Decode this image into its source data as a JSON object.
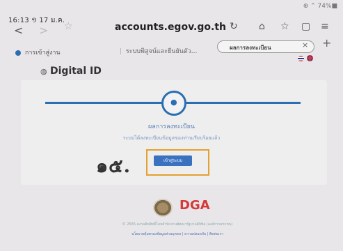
{
  "status_bar": {
    "time": "16:13 ១ 17 ม.ค.",
    "right": "⊕ ⌃ 74%■"
  },
  "browser": {
    "back": "<",
    "forward": ">",
    "url": "accounts.egov.go.th",
    "reload_icon": "reload-icon",
    "home_icon": "home-icon",
    "star_icon": "star-icon",
    "tabs_icon": "tabs-icon",
    "menu_icon": "menu-icon"
  },
  "tabs": [
    {
      "label": "การเข้าสู่งาน"
    },
    {
      "label": "ระบบพิสูจน์และยืนยันตัว..."
    },
    {
      "label": "ผลการลงทะเบียน",
      "active": true
    }
  ],
  "tab_close": "×",
  "tab_add": "+",
  "site": {
    "logo_text": "Digital ID"
  },
  "main": {
    "title": "ผลการลงทะเบียน",
    "description": "ระบบได้ลงทะเบียนข้อมูลของท่านเรียบร้อยแล้ว",
    "handwritten_number": "๑๕.",
    "button_label": "เข้าสู่ระบบ"
  },
  "footer": {
    "dga": "DGA",
    "dga_sub": "",
    "copyright": "© 2565 สงวนลิขสิทธิ์โดยสำนักงานพัฒนารัฐบาลดิจิทัล (องค์การมหาชน)",
    "links": "นโยบายคุ้มครองข้อมูลส่วนบุคคล | ความปลอดภัย | ติดต่อเรา"
  },
  "colors": {
    "accent": "#2b6fb0",
    "button": "#3b72c0",
    "highlight": "#e5a030",
    "dga": "#d43a3a"
  }
}
